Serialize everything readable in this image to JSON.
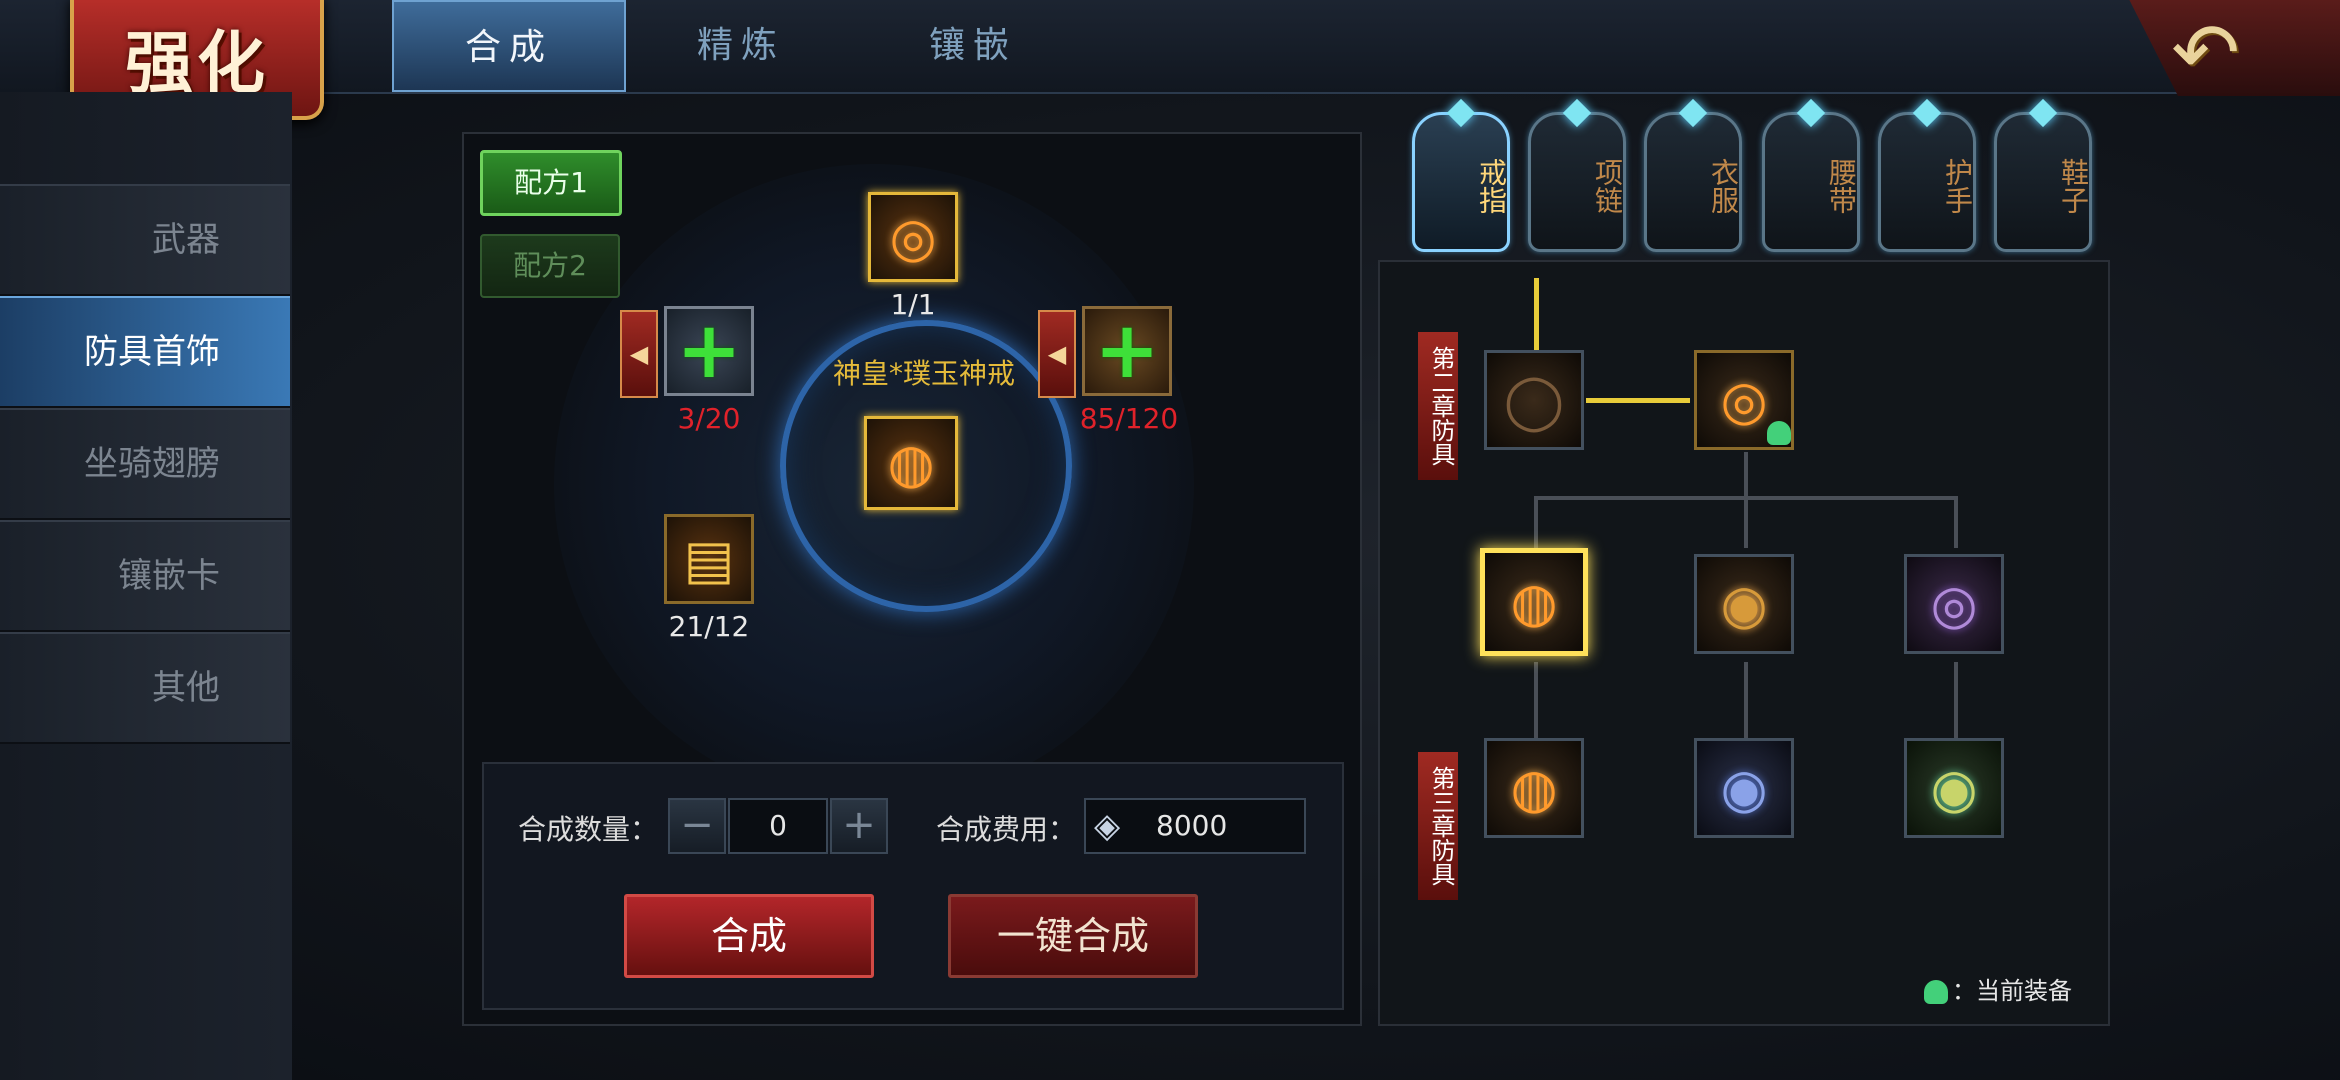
{
  "title": "强化",
  "tabs": [
    {
      "label": "合成",
      "active": true
    },
    {
      "label": "精炼",
      "active": false
    },
    {
      "label": "镶嵌",
      "active": false
    }
  ],
  "sidebar": {
    "items": [
      {
        "label": "武器"
      },
      {
        "label": "防具首饰",
        "active": true
      },
      {
        "label": "坐骑翅膀"
      },
      {
        "label": "镶嵌卡"
      },
      {
        "label": "其他"
      }
    ]
  },
  "recipes": [
    "配方1",
    "配方2"
  ],
  "synthesis": {
    "target_count": "1/1",
    "target_name": "神皇*璞玉神戒",
    "material_left_count": "3/20",
    "material_right_count": "85/120",
    "scroll_count": "21/12",
    "quantity_label": "合成数量：",
    "quantity_value": "0",
    "cost_label": "合成费用：",
    "cost_value": "8000",
    "craft_button": "合成",
    "craft_all_button": "一键合成"
  },
  "equipment_tabs": [
    {
      "label": "戒指",
      "active": true
    },
    {
      "label": "项链"
    },
    {
      "label": "衣服"
    },
    {
      "label": "腰带"
    },
    {
      "label": "护手"
    },
    {
      "label": "鞋子"
    }
  ],
  "tree": {
    "chapter_top": "第二章防具",
    "chapter_bottom": "第三章防具",
    "legend": "：当前装备"
  },
  "colors": {
    "accent_blue": "#3a79b6",
    "gold": "#e5bb3a",
    "count_red": "#e0222a",
    "craft_red": "#b3262a",
    "plus_green": "#3ee039"
  }
}
